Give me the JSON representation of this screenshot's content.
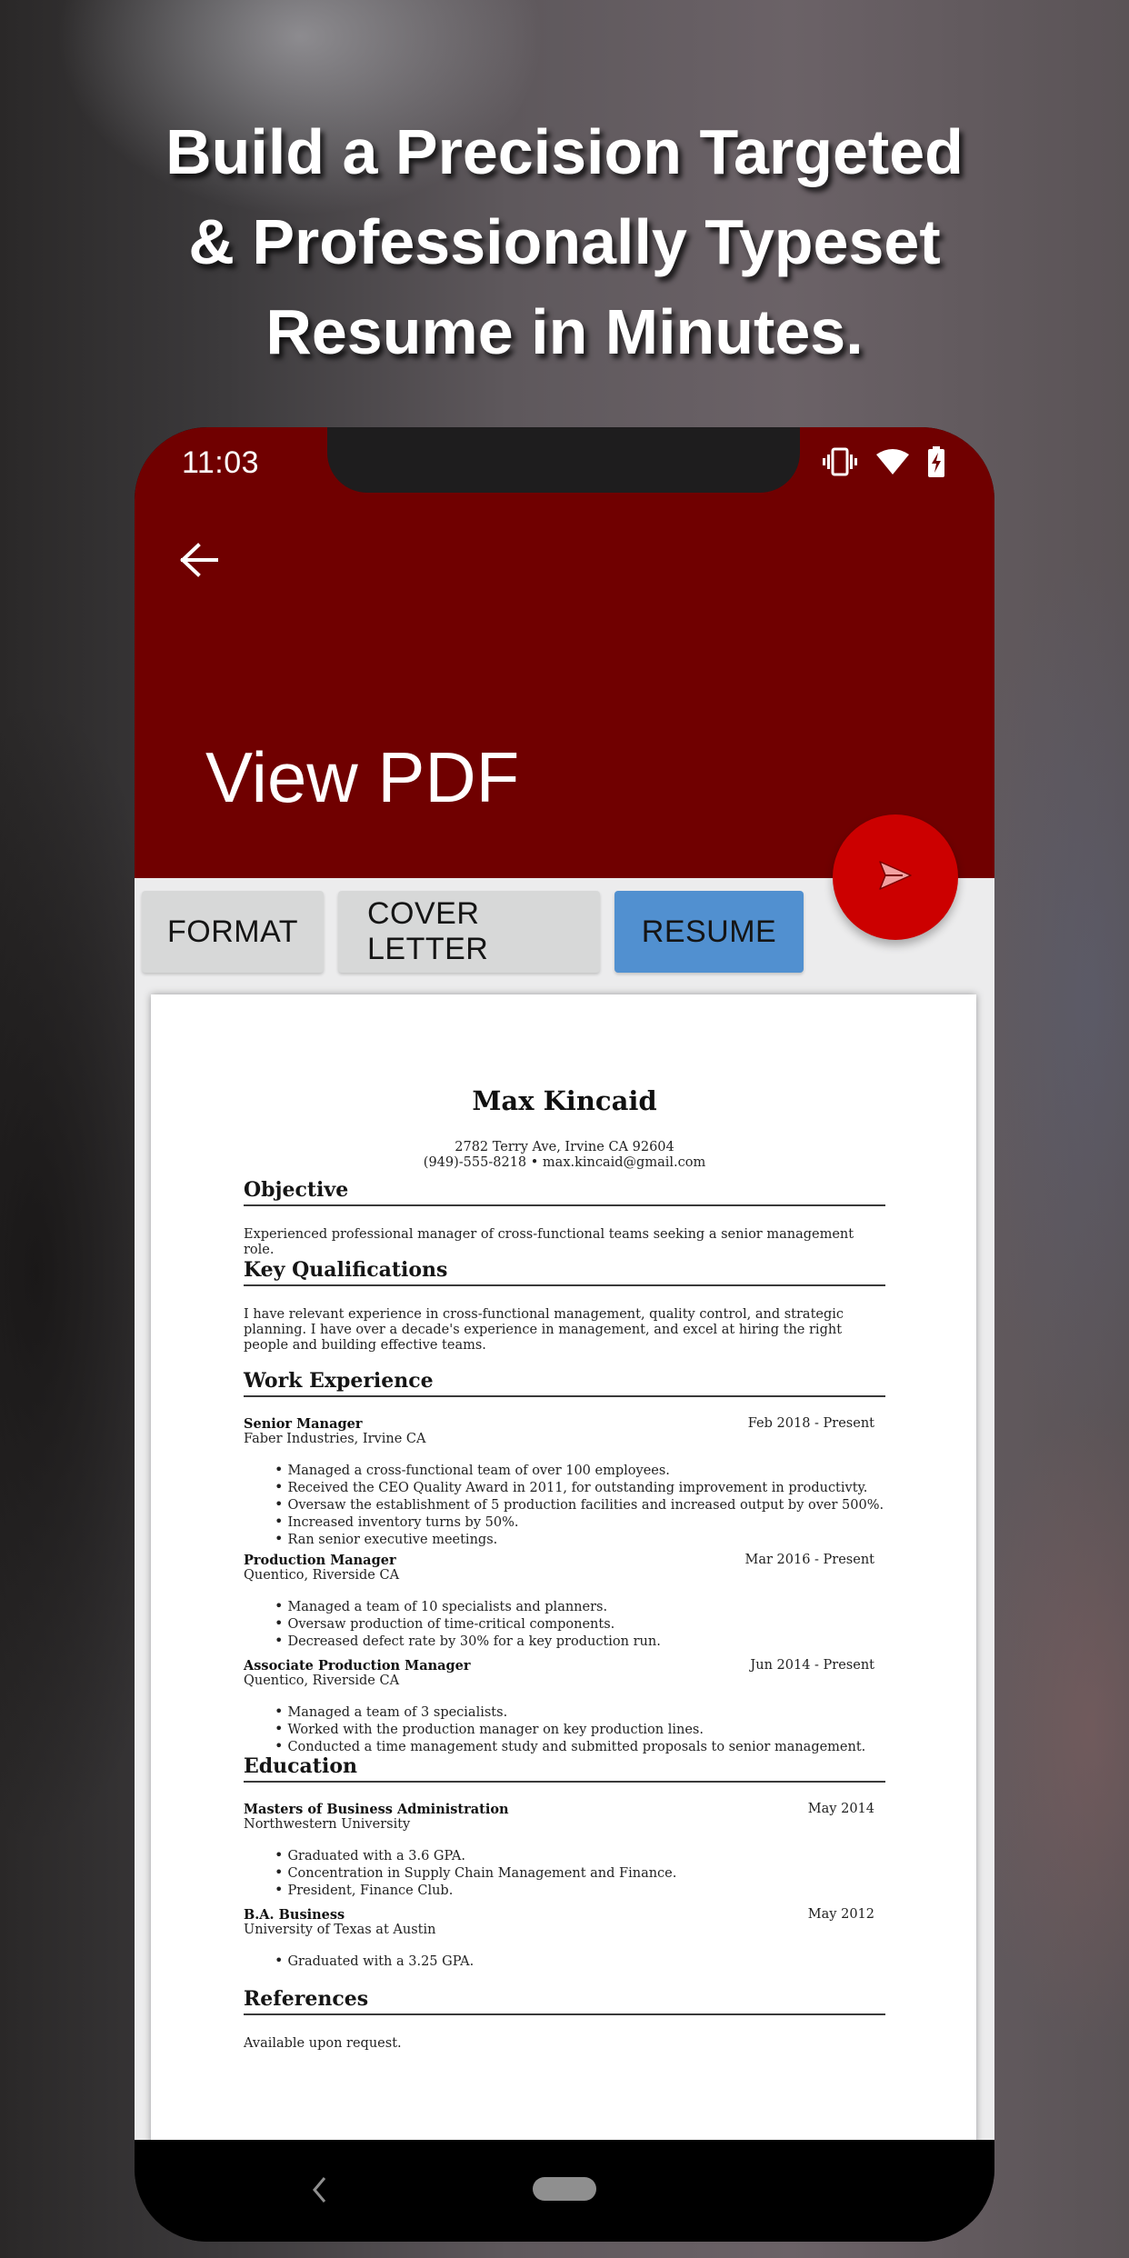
{
  "promo": {
    "headline_lines": [
      "Build a Precision Targeted",
      "& Professionally Typeset",
      "Resume in Minutes."
    ]
  },
  "status_bar": {
    "time": "11:03",
    "icons": [
      "vibrate-icon",
      "wifi-icon",
      "battery-charging-icon"
    ]
  },
  "app_bar": {
    "back_icon": "arrow-left-icon",
    "title": "View PDF",
    "color": "#700000"
  },
  "fab": {
    "icon": "send-icon",
    "color": "#cc0000"
  },
  "tabs": [
    {
      "label": "FORMAT",
      "active": false
    },
    {
      "label": "COVER LETTER",
      "active": false
    },
    {
      "label": "RESUME",
      "active": true
    }
  ],
  "colors": {
    "active_tab": "#5190d0",
    "inactive_tab": "#d7d8d8"
  },
  "resume": {
    "name": "Max Kincaid",
    "address": "2782 Terry Ave, Irvine CA 92604",
    "contact": "(949)-555-8218 • max.kincaid@gmail.com",
    "objective": {
      "heading": "Objective",
      "text": "Experienced professional manager of cross-functional teams seeking a senior management role."
    },
    "qualifications": {
      "heading": "Key Qualifications",
      "text": "I have relevant experience in cross-functional management, quality control, and strategic planning. I have over a decade's experience in management, and excel at hiring the right people and building effective teams."
    },
    "work": {
      "heading": "Work Experience",
      "jobs": [
        {
          "title": "Senior Manager",
          "dates": "Feb 2018 - Present",
          "company": "Faber Industries, Irvine CA",
          "bullets": [
            "Managed a cross-functional team of over 100 employees.",
            "Received the CEO Quality Award in 2011, for outstanding improvement in productivty.",
            "Oversaw the establishment of 5 production facilities and increased output by over 500%.",
            "Increased inventory turns by 50%.",
            "Ran senior executive meetings."
          ]
        },
        {
          "title": "Production Manager",
          "dates": "Mar 2016 - Present",
          "company": "Quentico, Riverside CA",
          "bullets": [
            "Managed a team of 10 specialists and planners.",
            "Oversaw production of time-critical components.",
            "Decreased defect rate by 30% for a key production run."
          ]
        },
        {
          "title": "Associate Production Manager",
          "dates": "Jun 2014 - Present",
          "company": "Quentico, Riverside CA",
          "bullets": [
            "Managed a team of 3 specialists.",
            "Worked with the production manager on key production lines.",
            "Conducted a time management study and submitted proposals to senior management."
          ]
        }
      ]
    },
    "education": {
      "heading": "Education",
      "degrees": [
        {
          "title": "Masters of Business Administration",
          "date": "May 2014",
          "school": "Northwestern University",
          "bullets": [
            "Graduated with a 3.6 GPA.",
            "Concentration in Supply Chain Management and Finance.",
            "President, Finance Club."
          ]
        },
        {
          "title": "B.A. Business",
          "date": "May 2012",
          "school": "University of Texas at Austin",
          "bullets": [
            "Graduated with a 3.25 GPA."
          ]
        }
      ]
    },
    "references": {
      "heading": "References",
      "text": "Available upon request."
    }
  },
  "nav_bar": {
    "back_icon": "nav-back-icon",
    "home_icon": "nav-home-pill"
  }
}
